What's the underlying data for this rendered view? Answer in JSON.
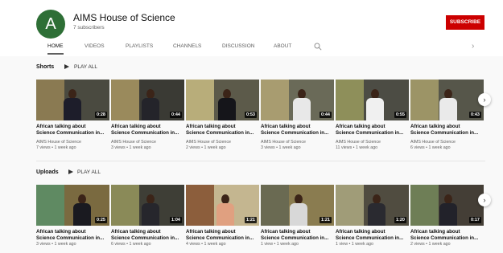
{
  "channel": {
    "avatar_letter": "A",
    "name": "AIMS House of Science",
    "subscribers": "7 subscribers",
    "subscribe_label": "SUBSCRIBE",
    "avatar_color": "#2e6f36",
    "subscribe_color": "#cc0000"
  },
  "tabs": [
    {
      "label": "HOME",
      "active": true
    },
    {
      "label": "VIDEOS"
    },
    {
      "label": "PLAYLISTS"
    },
    {
      "label": "CHANNELS"
    },
    {
      "label": "DISCUSSION"
    },
    {
      "label": "ABOUT"
    }
  ],
  "icons": {
    "search": "search-icon",
    "tabs_next": "chevron-right-icon",
    "play": "play-icon",
    "shelf_next": "chevron-right-icon"
  },
  "shorts": {
    "title": "Shorts",
    "play_all": "PLAY ALL",
    "videos": [
      {
        "title1": "African talking about",
        "title2": "Science Communication in...",
        "channel": "AIMS House of Science",
        "meta": "7 views • 1 week ago",
        "duration": "0:28"
      },
      {
        "title1": "African talking about",
        "title2": "Science Communication in...",
        "channel": "AIMS House of Science",
        "meta": "3 views • 1 week ago",
        "duration": "0:44"
      },
      {
        "title1": "African talking about",
        "title2": "Science Communication in...",
        "channel": "AIMS House of Science",
        "meta": "2 views • 1 week ago",
        "duration": "0:53"
      },
      {
        "title1": "African talking about",
        "title2": "Science Communication in...",
        "channel": "AIMS House of Science",
        "meta": "3 views • 1 week ago",
        "duration": "0:44"
      },
      {
        "title1": "African talking about",
        "title2": "Science Communication in...",
        "channel": "AIMS House of Science",
        "meta": "11 views • 1 week ago",
        "duration": "0:55"
      },
      {
        "title1": "African talking about",
        "title2": "Science Communication in...",
        "channel": "AIMS House of Science",
        "meta": "6 views • 1 week ago",
        "duration": "0:43"
      }
    ]
  },
  "uploads": {
    "title": "Uploads",
    "play_all": "PLAY ALL",
    "videos": [
      {
        "title1": "African talking about",
        "title2": "Science Communication in...",
        "meta": "3 views • 1 week ago",
        "duration": "0:25"
      },
      {
        "title1": "African talking about",
        "title2": "Science Communication in...",
        "meta": "6 views • 1 week ago",
        "duration": "1:04"
      },
      {
        "title1": "African talking about",
        "title2": "Science Communication in...",
        "meta": "4 views • 1 week ago",
        "duration": "1:21"
      },
      {
        "title1": "African talking about",
        "title2": "Science Communication in...",
        "meta": "1 view • 1 week ago",
        "duration": "1:21"
      },
      {
        "title1": "African talking about",
        "title2": "Science Communication in...",
        "meta": "1 view • 1 week ago",
        "duration": "1:20"
      },
      {
        "title1": "African talking about",
        "title2": "Science Communication in...",
        "meta": "2 views • 1 week ago",
        "duration": "0:17"
      }
    ]
  }
}
